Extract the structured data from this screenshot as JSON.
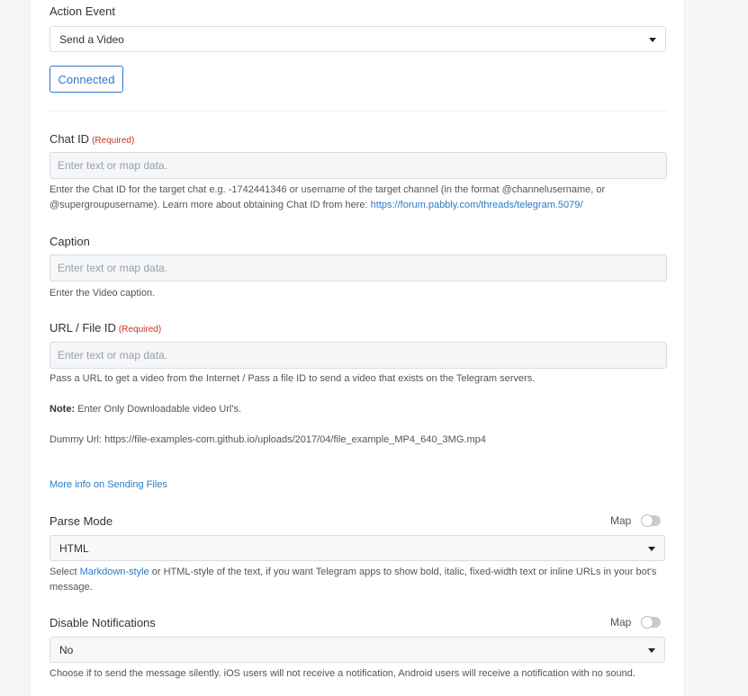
{
  "action_event": {
    "label": "Action Event",
    "selected": "Send a Video",
    "connected_label": "Connected"
  },
  "required_tag": "(Required)",
  "placeholder": "Enter text or map data.",
  "chat_id": {
    "label": "Chat ID",
    "help": "Enter the Chat ID for the target chat e.g. -1742441346 or username of the target channel (in the format @channelusername, or @supergroupusername). Learn more about obtaining Chat ID from here: ",
    "help_link": "https://forum.pabbly.com/threads/telegram.5079/"
  },
  "caption": {
    "label": "Caption",
    "help": "Enter the Video caption."
  },
  "url_file_id": {
    "label": "URL / File ID",
    "help": "Pass a URL to get a video from the Internet / Pass a file ID to send a video that exists on the Telegram servers.",
    "note_label": "Note:",
    "note_text": " Enter Only Downloadable video Url's.",
    "dummy_url": "Dummy Url: https://file-examples-com.github.io/uploads/2017/04/file_example_MP4_640_3MG.mp4",
    "more_info_link": "More info on Sending Files"
  },
  "parse_mode": {
    "label": "Parse Mode",
    "map_label": "Map",
    "selected": "HTML",
    "help_before": "Select ",
    "help_link": "Markdown-style",
    "help_after": " or HTML-style of the text, if you want Telegram apps to show bold, italic, fixed-width text or inline URLs in your bot's message."
  },
  "disable_notifications": {
    "label": "Disable Notifications",
    "map_label": "Map",
    "selected": "No",
    "help": "Choose if to send the message silently. iOS users will not receive a notification, Android users will receive a notification with no sound."
  }
}
